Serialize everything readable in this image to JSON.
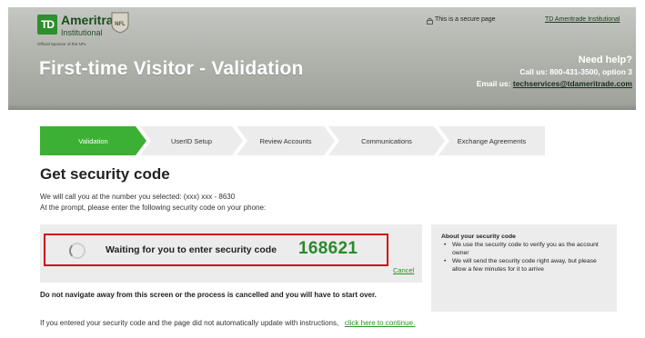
{
  "header": {
    "logo_mark": "TD",
    "brand_name": "Ameritrade",
    "brand_sub": "Institutional",
    "sponsor_text": "Official Sponsor of the NFL",
    "nfl_mark": "NFL",
    "secure_text": "This is a secure page",
    "institutional_link": "TD Ameritrade Institutional",
    "page_title": "First-time Visitor - Validation",
    "help_title": "Need help?",
    "help_call": "Call us: 800-431-3500, option 3",
    "help_email_label": "Email us: ",
    "help_email": "techservices@tdameritrade.com"
  },
  "steps": [
    {
      "label": "Validation",
      "active": true
    },
    {
      "label": "UserID Setup",
      "active": false
    },
    {
      "label": "Review Accounts",
      "active": false
    },
    {
      "label": "Communications",
      "active": false
    },
    {
      "label": "Exchange Agreements",
      "active": false
    }
  ],
  "main": {
    "title": "Get security code",
    "intro_line1": "We will call you at the number you selected: (xxx) xxx - 8630",
    "intro_line2": "At the prompt, please enter the following security code on your phone:",
    "waiting_text": "Waiting for you to enter security code",
    "security_code": "168621",
    "cancel_label": "Cancel",
    "warning": "Do not navigate away from this screen or the process is cancelled and you will have to start over.",
    "continue_prefix": "If you entered your security code and the page did not automatically update with instructions,",
    "continue_link": "click here to continue."
  },
  "info": {
    "title": "About your security code",
    "items": [
      "We use the security code to verify you as the account owner",
      "We will send the security code right away, but please allow a few minutes for it to arrive"
    ]
  },
  "colors": {
    "accent_green": "#3cb034",
    "code_green": "#2a8a2a",
    "alert_red": "#d01010"
  }
}
